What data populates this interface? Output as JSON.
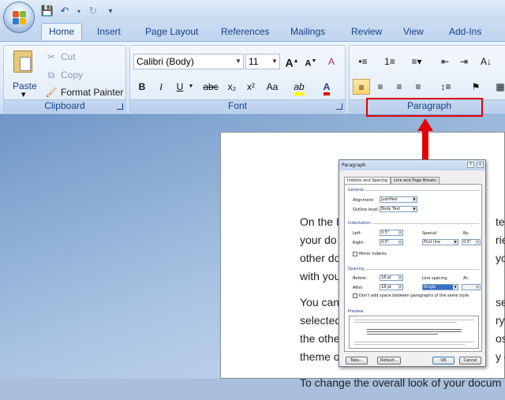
{
  "quick_access": {
    "office_icon": "office-logo",
    "save_icon": "save-icon",
    "undo_icon": "undo-icon",
    "redo_icon": "redo-icon",
    "customize_icon": "chevron-down-icon"
  },
  "tabs": [
    {
      "label": "Home",
      "active": true
    },
    {
      "label": "Insert"
    },
    {
      "label": "Page Layout"
    },
    {
      "label": "References"
    },
    {
      "label": "Mailings"
    },
    {
      "label": "Review"
    },
    {
      "label": "View"
    },
    {
      "label": "Add-Ins"
    }
  ],
  "clipboard": {
    "label": "Clipboard",
    "paste": "Paste",
    "cut": "Cut",
    "copy": "Copy",
    "format_painter": "Format Painter"
  },
  "font": {
    "label": "Font",
    "family": "Calibri (Body)",
    "size": "11",
    "grow": "A",
    "shrink": "A",
    "clear": "A",
    "bold": "B",
    "italic": "I",
    "underline": "U",
    "strike": "abc",
    "subscript": "x₂",
    "superscript": "x²",
    "change_case": "Aa",
    "highlight": "ab",
    "color": "A"
  },
  "paragraph": {
    "label": "Paragraph"
  },
  "document": {
    "paragraphs": [
      [
        "On the I",
        "your do",
        "other do",
        "with you"
      ],
      [
        "You can",
        "selected",
        "the othe",
        "theme o"
      ],
      [
        "To change the overall look of your docum"
      ]
    ],
    "right_fragments": [
      "ter",
      "rie",
      "yo",
      "",
      "se",
      "ry",
      "ost",
      "y c"
    ]
  },
  "dialog": {
    "title": "Paragraph",
    "tabs": [
      "Indents and Spacing",
      "Line and Page Breaks"
    ],
    "general": "General",
    "alignment_label": "Alignment:",
    "alignment_value": "Justified",
    "outline_label": "Outline level:",
    "outline_value": "Body Text",
    "indentation": "Indentation",
    "left_label": "Left:",
    "left_value": "0.5\"",
    "right_label": "Right:",
    "right_value": "0.5\"",
    "special_label": "Special:",
    "special_value": "First line",
    "by_label": "By:",
    "by_value": "0.5\"",
    "mirror_label": "Mirror indents",
    "spacing": "Spacing",
    "before_label": "Before:",
    "before_value": "18 pt",
    "after_label": "After:",
    "after_value": "18 pt",
    "line_spacing_label": "Line spacing:",
    "line_spacing_value": "Single",
    "at_label": "At:",
    "dont_add_label": "Don't add space between paragraphs of the same style",
    "preview": "Preview",
    "tabs_button": "Tabs...",
    "default_button": "Default...",
    "ok_button": "OK",
    "cancel_button": "Cancel"
  },
  "colors": {
    "highlight_box": "#e00000",
    "arrow": "#e40000",
    "font_color": "#e00000",
    "highlight_color": "#ffff00"
  }
}
